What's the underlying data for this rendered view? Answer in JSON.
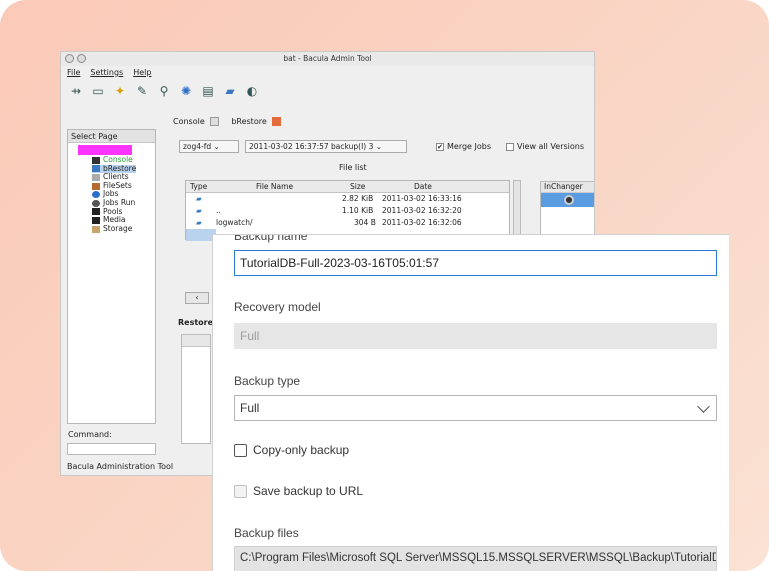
{
  "bat_window": {
    "title": "bat - Bacula Admin Tool",
    "menu": [
      "File",
      "Settings",
      "Help"
    ],
    "toolbar_icons": [
      "connect-icon",
      "window-icon",
      "star-icon",
      "edit-icon",
      "query-icon",
      "refresh-icon",
      "label-icon",
      "folder-icon",
      "status-icon"
    ],
    "select_page_label": "Select Page",
    "tree_items": [
      {
        "label": "Console",
        "icon": "console-icon",
        "color": "#2c9c3a"
      },
      {
        "label": "bRestore",
        "icon": "restore-icon",
        "color": "#222222"
      },
      {
        "label": "Clients",
        "icon": "clients-icon",
        "color": "#222222"
      },
      {
        "label": "FileSets",
        "icon": "filesets-icon",
        "color": "#222222"
      },
      {
        "label": "Jobs",
        "icon": "jobs-icon",
        "color": "#222222"
      },
      {
        "label": "Jobs Run",
        "icon": "jobs-run-icon",
        "color": "#222222"
      },
      {
        "label": "Pools",
        "icon": "pools-icon",
        "color": "#222222"
      },
      {
        "label": "Media",
        "icon": "media-icon",
        "color": "#222222"
      },
      {
        "label": "Storage",
        "icon": "storage-icon",
        "color": "#222222"
      }
    ],
    "command_label": "Command:",
    "status": "Bacula Administration Tool",
    "tabs": {
      "console": "Console",
      "brestore": "bRestore"
    },
    "client_combo": "zog4-fd",
    "job_combo": "2011-03-02 16:37:57 backup(I) 3",
    "merge_jobs_label": "Merge Jobs",
    "view_all_label": "View all Versions",
    "file_list_label": "File list",
    "file_columns": [
      "Type",
      "File Name",
      "Size",
      "Date"
    ],
    "file_rows": [
      {
        "name": "",
        "size": "2.82 KiB",
        "date": "2011-03-02 16:33:16"
      },
      {
        "name": "..",
        "size": "1.10 KiB",
        "date": "2011-03-02 16:32:20"
      },
      {
        "name": "logwatch/",
        "size": "304 B",
        "date": "2011-03-02 16:32:06"
      }
    ],
    "restore_label": "Restore",
    "changer_header": "InChanger"
  },
  "backup_panel": {
    "backup_name_label": "Backup name",
    "backup_name_value": "TutorialDB-Full-2023-03-16T05:01:57",
    "recovery_model_label": "Recovery model",
    "recovery_model_value": "Full",
    "backup_type_label": "Backup type",
    "backup_type_value": "Full",
    "copy_only_label": "Copy-only backup",
    "save_url_label": "Save backup to URL",
    "backup_files_label": "Backup files",
    "backup_files_value": "C:\\Program Files\\Microsoft SQL Server\\MSSQL15.MSSQLSERVER\\MSSQL\\Backup\\TutorialDB-"
  },
  "colors": {
    "accent": "#2b7bd6",
    "tree_root_highlight": "#ff33ff",
    "changer_selected": "#5b9be0"
  }
}
